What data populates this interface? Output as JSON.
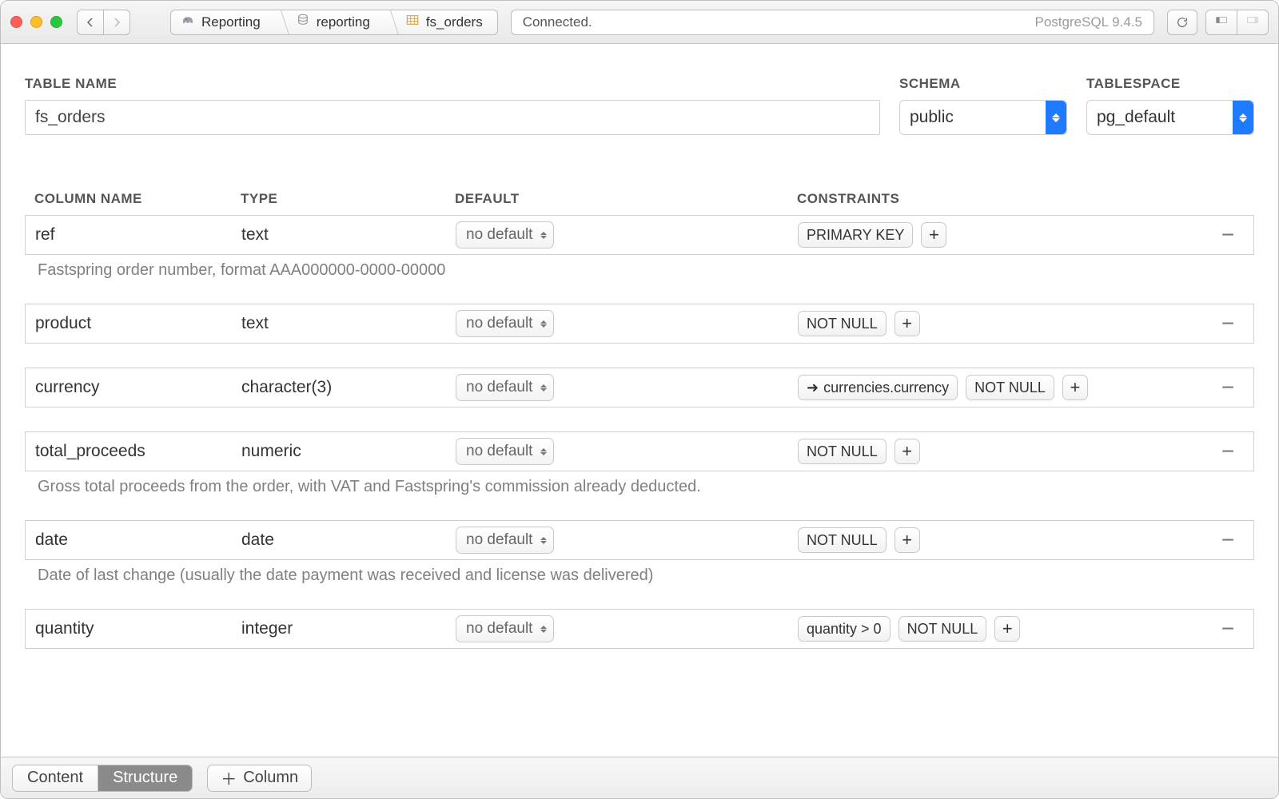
{
  "breadcrumb": {
    "connection": "Reporting",
    "database": "reporting",
    "table": "fs_orders"
  },
  "status": {
    "text": "Connected.",
    "server": "PostgreSQL 9.4.5"
  },
  "labels": {
    "table_name": "Table Name",
    "schema": "Schema",
    "tablespace": "Tablespace",
    "column_name": "Column Name",
    "type": "Type",
    "default": "Default",
    "constraints": "Constraints",
    "no_default": "no default",
    "remove": "−",
    "add": "+",
    "arrow": "➜"
  },
  "table": {
    "name": "fs_orders",
    "schema": "public",
    "tablespace": "pg_default"
  },
  "columns": [
    {
      "name": "ref",
      "type": "text",
      "default": "no default",
      "constraints": [
        "PRIMARY KEY"
      ],
      "fk": null,
      "desc": "Fastspring order number, format AAA000000-0000-00000"
    },
    {
      "name": "product",
      "type": "text",
      "default": "no default",
      "constraints": [
        "NOT NULL"
      ],
      "fk": null,
      "desc": ""
    },
    {
      "name": "currency",
      "type": "character(3)",
      "default": "no default",
      "constraints": [
        "NOT NULL"
      ],
      "fk": "currencies.currency",
      "desc": ""
    },
    {
      "name": "total_proceeds",
      "type": "numeric",
      "default": "no default",
      "constraints": [
        "NOT NULL"
      ],
      "fk": null,
      "desc": "Gross total proceeds from the order, with VAT and Fastspring's commission already deducted."
    },
    {
      "name": "date",
      "type": "date",
      "default": "no default",
      "constraints": [
        "NOT NULL"
      ],
      "fk": null,
      "desc": "Date of last change (usually the date payment was received and license was delivered)"
    },
    {
      "name": "quantity",
      "type": "integer",
      "default": "no default",
      "constraints": [
        "quantity > 0",
        "NOT NULL"
      ],
      "fk": null,
      "desc": ""
    }
  ],
  "bottom": {
    "tab_content": "Content",
    "tab_structure": "Structure",
    "add_column": "Column"
  }
}
